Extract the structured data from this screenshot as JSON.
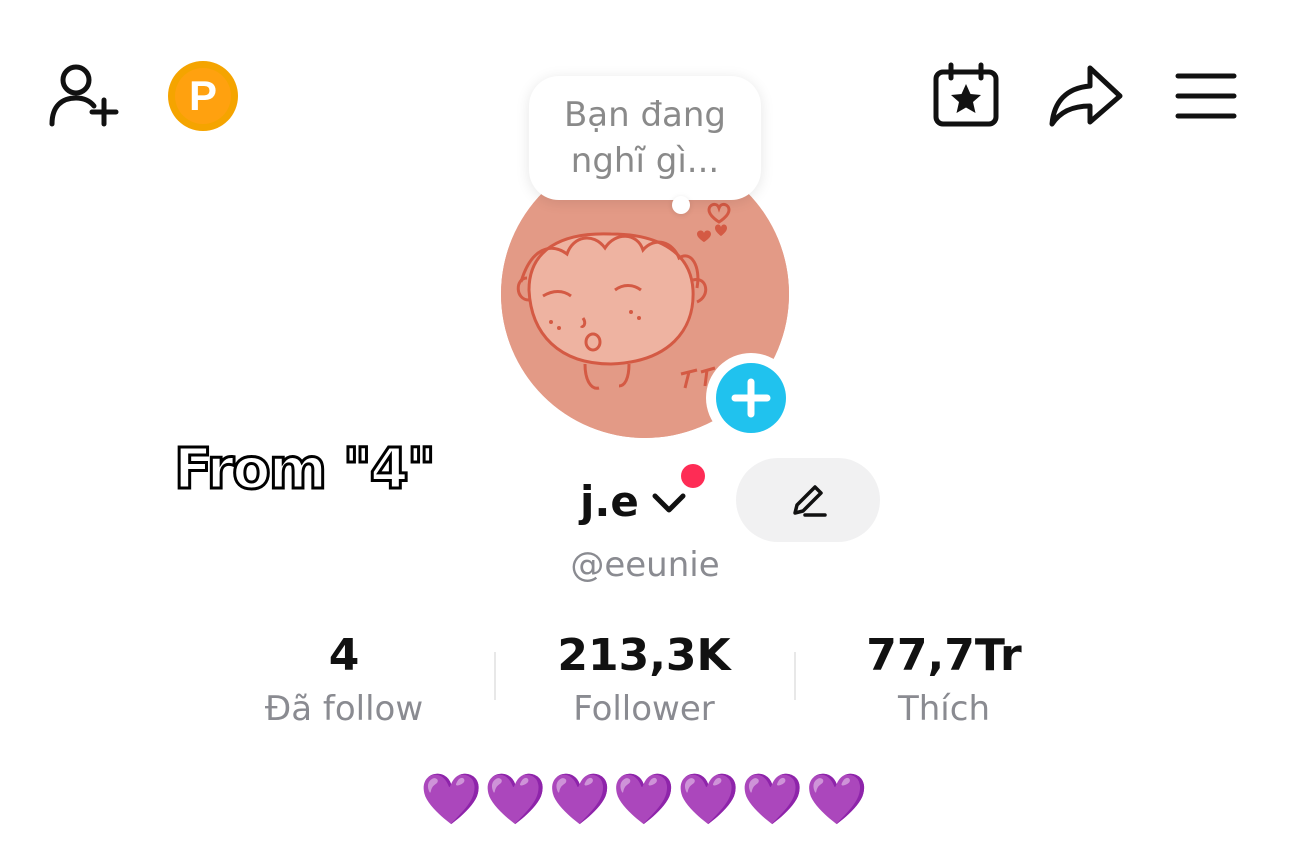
{
  "header": {
    "add_friend_icon": "person-add-icon",
    "points_icon": "coin-p-icon",
    "points_letter": "P",
    "calendar_icon": "calendar-star-icon",
    "share_icon": "share-arrow-icon",
    "menu_icon": "hamburger-menu-icon"
  },
  "note_bubble": {
    "text_line1": "Bạn đang",
    "text_line2": "nghĩ gì..."
  },
  "overlay": {
    "caption": "From \"4\""
  },
  "profile": {
    "display_name": "j.e",
    "username": "@eeunie",
    "edit_icon": "pencil-icon",
    "add_avatar_icon": "plus-icon",
    "switch_icon": "chevron-down-icon"
  },
  "stats": [
    {
      "value": "4",
      "label": "Đã follow"
    },
    {
      "value": "213,3K",
      "label": "Follower"
    },
    {
      "value": "77,7Tr",
      "label": "Thích"
    }
  ],
  "bio": {
    "text": "💜💜💜💜💜💜💜"
  },
  "colors": {
    "accent_blue": "#20c2ee",
    "notification_red": "#fe2c55",
    "coin_orange": "#f5a400",
    "avatar_bg": "#e39a86",
    "muted_text": "#8a8b91",
    "heart_purple": "#9b3df0"
  }
}
